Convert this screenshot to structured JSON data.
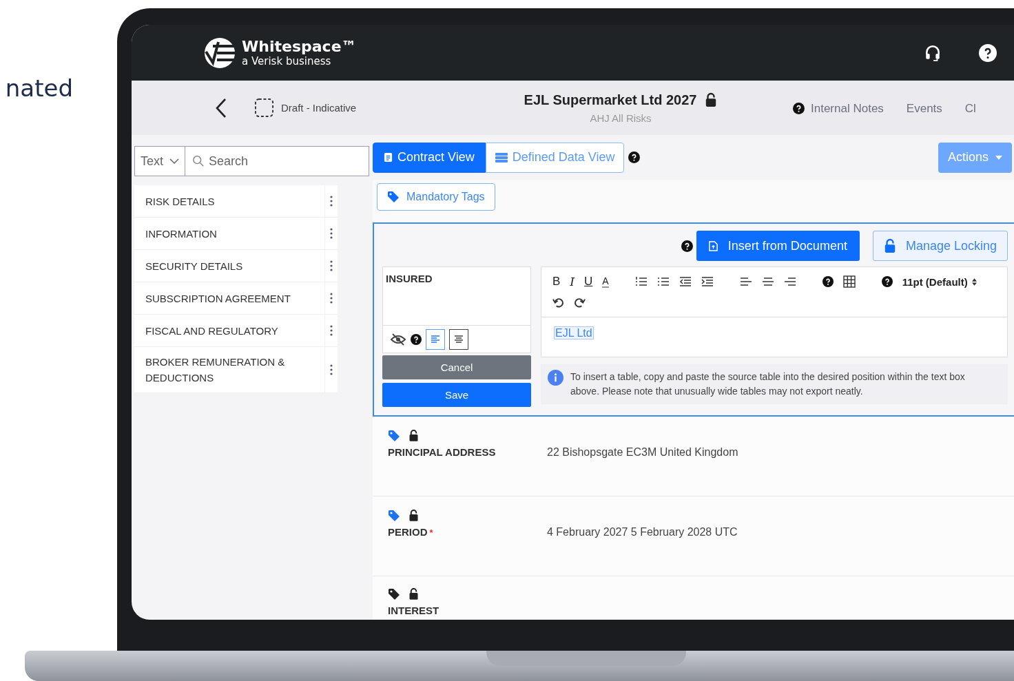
{
  "side_text": "nated",
  "header": {
    "logo_name": "Whitespace™",
    "logo_sub": "a Verisk business"
  },
  "subheader": {
    "status": "Draft - Indicative",
    "title": "EJL Supermarket Ltd 2027",
    "locked": false,
    "subtitle": "AHJ All Risks",
    "links": [
      {
        "label": "Internal Notes",
        "help": true
      },
      {
        "label": "Events",
        "help": false
      },
      {
        "label": "Cl",
        "help": false
      }
    ]
  },
  "sidebar": {
    "filter": "Text",
    "search_placeholder": "Search",
    "items": [
      {
        "label": "RISK DETAILS"
      },
      {
        "label": "INFORMATION"
      },
      {
        "label": "SECURITY DETAILS"
      },
      {
        "label": "SUBSCRIPTION AGREEMENT"
      },
      {
        "label": "FISCAL AND REGULATORY"
      },
      {
        "label": "BROKER REMUNERATION & DEDUCTIONS"
      }
    ]
  },
  "view_tabs": [
    {
      "label": "Contract View",
      "selected": true
    },
    {
      "label": "Defined Data View",
      "selected": false
    }
  ],
  "actions": "Actions",
  "mandatory_tags": "Mandatory Tags",
  "editor": {
    "insert_button": "Insert from Document",
    "lock_button": "Manage Locking",
    "field_label": "INSURED",
    "align": [
      {
        "selected": true
      },
      {
        "selected": false
      }
    ],
    "cancel": "Cancel",
    "save": "Save",
    "format_buttons": [
      "B",
      "I",
      "U",
      "A"
    ],
    "font_size": "11pt (Default)",
    "content": "EJL Ltd",
    "note": "To insert a table, copy and paste the source table into the desired position within the text box above. Please note that unusually wide tables may not export neatly."
  },
  "fields": [
    {
      "label": "PRINCIPAL ADDRESS",
      "tagged": true,
      "locked": false,
      "value": "22 Bishopsgate EC3M United Kingdom"
    },
    {
      "label": "PERIOD",
      "required_mark": "*",
      "tagged": true,
      "locked": false,
      "value": "4 February 2027 5 February 2028 UTC"
    },
    {
      "label": "INTEREST",
      "tagged": false,
      "locked": false
    }
  ]
}
